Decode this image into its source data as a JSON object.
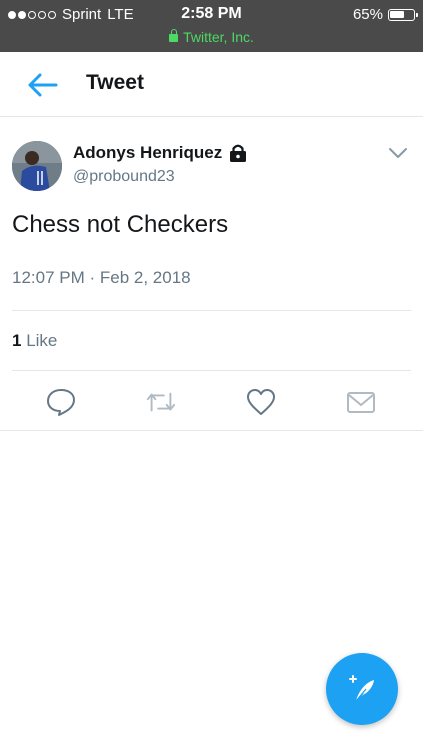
{
  "status_bar": {
    "carrier": "Sprint",
    "network": "LTE",
    "time": "2:58 PM",
    "battery": "65%",
    "battery_level": 0.65,
    "secure_site": "Twitter, Inc."
  },
  "nav": {
    "title": "Tweet",
    "back_icon": "arrow-left-icon"
  },
  "tweet": {
    "author_name": "Adonys Henriquez",
    "handle": "@probound23",
    "protected_icon": "lock-icon",
    "text": "Chess not Checkers",
    "timestamp": "12:07 PM · Feb 2, 2018",
    "likes_count": "1",
    "likes_label": "Like"
  },
  "actions": [
    "reply-icon",
    "retweet-icon",
    "like-icon",
    "share-icon"
  ],
  "compose": {
    "icon": "compose-feather-icon"
  },
  "colors": {
    "accent": "#1da1f2",
    "status_bar": "#4a4a4a",
    "secure_green": "#4cd964",
    "secondary_text": "#657786"
  }
}
